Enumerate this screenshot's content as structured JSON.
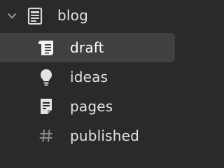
{
  "tree": {
    "parent": {
      "label": "blog",
      "icon": "notebook-icon",
      "expanded": true
    },
    "children": [
      {
        "label": "draft",
        "icon": "scroll-icon",
        "selected": true
      },
      {
        "label": "ideas",
        "icon": "lightbulb-icon",
        "selected": false
      },
      {
        "label": "pages",
        "icon": "document-icon",
        "selected": false
      },
      {
        "label": "published",
        "icon": "hashtag-icon",
        "selected": false
      }
    ]
  },
  "colors": {
    "background": "#2a2a2c",
    "selected_row": "#404042",
    "text": "#e4e4e4",
    "icon": "#d8d8d8",
    "icon_dim": "#8a8a8a"
  }
}
